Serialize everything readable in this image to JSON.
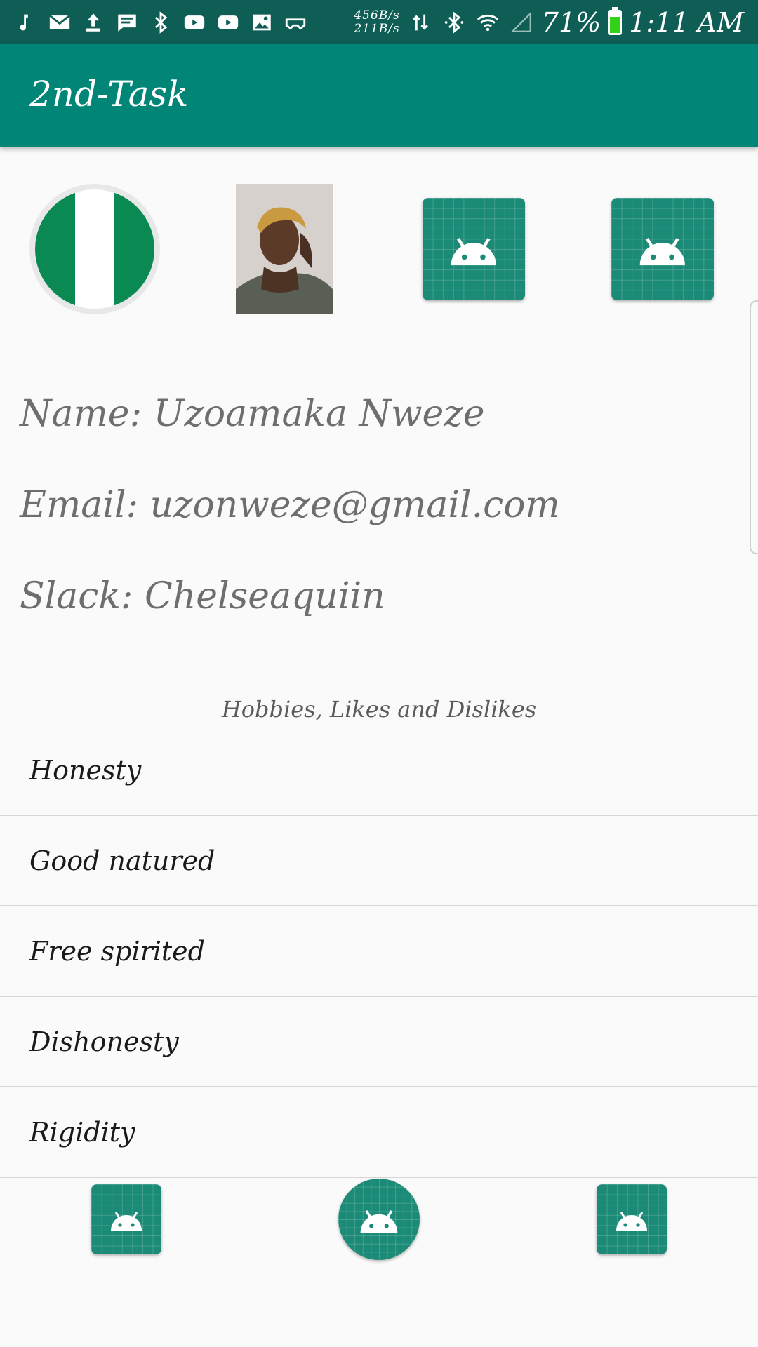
{
  "status_bar": {
    "left_icons": [
      "music-note-icon",
      "mail-icon",
      "upload-icon",
      "message-icon",
      "bluetooth-icon",
      "youtube-icon",
      "youtube-icon",
      "image-icon",
      "vr-headset-icon"
    ],
    "upload_speed": "456B/s",
    "download_speed": "211B/s",
    "battery_percent": "71%",
    "battery_level": 0.71,
    "time": "1:11 AM"
  },
  "app_bar": {
    "title": "2nd-Task"
  },
  "profile": {
    "name_line": "Name: Uzoamaka Nweze",
    "email_line": "Email: uzonweze@gmail.com",
    "slack_line": "Slack: Chelseaquiin"
  },
  "section": {
    "heading": "Hobbies, Likes and Dislikes"
  },
  "traits": [
    "Honesty",
    "Good natured",
    "Free spirited",
    "Dishonesty",
    "Rigidity"
  ],
  "colors": {
    "status_bar": "#0f5e55",
    "app_bar": "#008577",
    "android_tile": "#1b8a76",
    "background": "#fafafa"
  }
}
